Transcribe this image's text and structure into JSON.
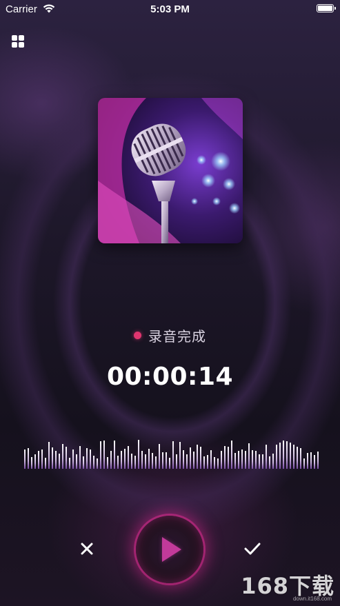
{
  "status_bar": {
    "carrier": "Carrier",
    "time": "5:03 PM"
  },
  "top_bar": {
    "menu_icon": "grid-icon"
  },
  "cover": {
    "image": "microphone-artwork"
  },
  "recording": {
    "status_label": "录音完成",
    "duration": "00:00:14",
    "status_color": "#e0356f"
  },
  "controls": {
    "cancel_icon": "close-icon",
    "play_icon": "play-icon",
    "confirm_icon": "check-icon",
    "accent": "#c23a9a"
  },
  "watermark": {
    "text": "168下载",
    "url_text": "down.it168.com"
  }
}
